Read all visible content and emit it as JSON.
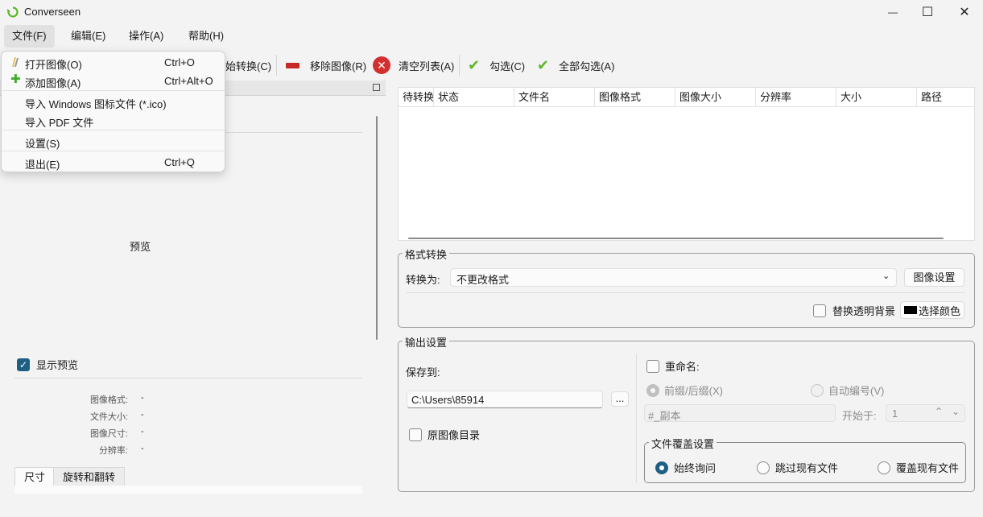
{
  "window": {
    "title": "Converseen",
    "minimize_glyph": "—",
    "maximize_glyph": "☐",
    "close_glyph": "✕"
  },
  "menubar": [
    {
      "label": "文件(F)"
    },
    {
      "label": "编辑(E)"
    },
    {
      "label": "操作(A)"
    },
    {
      "label": "帮助(H)"
    }
  ],
  "file_menu": {
    "items": [
      {
        "label": "打开图像(O)",
        "shortcut": "Ctrl+O",
        "icon": "open-folder-icon"
      },
      {
        "label": "添加图像(A)",
        "shortcut": "Ctrl+Alt+O",
        "icon": "plus-icon"
      },
      {
        "label": "导入 Windows 图标文件 (*.ico)",
        "shortcut": ""
      },
      {
        "label": "导入 PDF 文件",
        "shortcut": ""
      },
      {
        "label": "设置(S)",
        "shortcut": ""
      },
      {
        "label": "退出(E)",
        "shortcut": "Ctrl+Q"
      }
    ]
  },
  "toolbar": {
    "convert": "始转换(C)",
    "remove": "移除图像(R)",
    "clear": "清空列表(A)",
    "check": "勾选(C)",
    "check_all": "全部勾选(A)"
  },
  "left_panel": {
    "preview_label": "预览",
    "show_preview": "显示预览",
    "show_preview_checked": true,
    "info": [
      {
        "label": "图像格式:",
        "value": "-"
      },
      {
        "label": "文件大小:",
        "value": "-"
      },
      {
        "label": "图像尺寸:",
        "value": "-"
      },
      {
        "label": "分辨率:",
        "value": "-"
      }
    ],
    "tabs": [
      {
        "label": "尺寸"
      },
      {
        "label": "旋转和翻转"
      }
    ]
  },
  "file_table": {
    "columns": [
      "待转换",
      "状态",
      "文件名",
      "图像格式",
      "图像大小",
      "分辨率",
      "大小",
      "路径"
    ],
    "rows": []
  },
  "format_group": {
    "title": "格式转换",
    "convert_to_label": "转换为:",
    "format_value": "不更改格式",
    "image_settings_button": "图像设置",
    "replace_bg_label": "替换透明背景",
    "replace_bg_checked": false,
    "choose_color_button": "选择颜色",
    "bg_color": "#000000"
  },
  "output_group": {
    "title": "输出设置",
    "save_to_label": "保存到:",
    "path_value": "C:\\Users\\85914",
    "browse_button": "...",
    "original_dir_label": "原图像目录",
    "original_dir_checked": false,
    "rename_label": "重命名:",
    "rename_checked": false,
    "prefix_suffix_label": "前缀/后缀(X)",
    "auto_number_label": "自动编号(V)",
    "suffix_value": "#_副本",
    "start_at_label": "开始于:",
    "start_at_value": "1",
    "overwrite": {
      "title": "文件覆盖设置",
      "options": [
        {
          "label": "始终询问",
          "checked": true
        },
        {
          "label": "跳过现有文件",
          "checked": false
        },
        {
          "label": "覆盖现有文件",
          "checked": false
        }
      ]
    }
  },
  "colors": {
    "accent": "#1f5f84",
    "check_green": "#5cb82a",
    "remove_red": "#c62828"
  }
}
